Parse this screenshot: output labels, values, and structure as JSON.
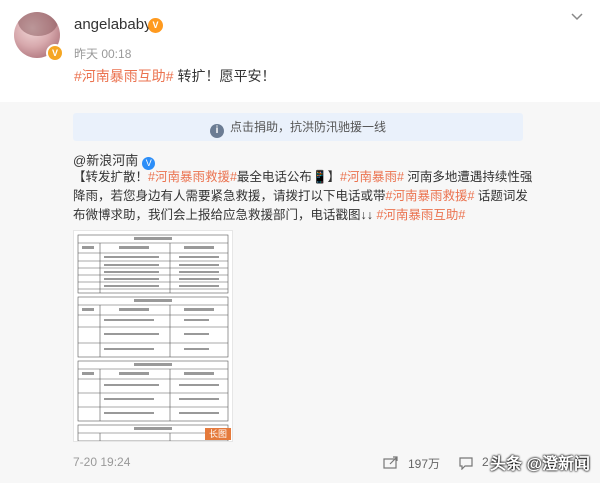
{
  "post": {
    "username": "angelababy",
    "vip_label": "V",
    "avatar_badge": "V",
    "time": "昨天 00:18",
    "topic": "#河南暴雨互助#",
    "text": " 转扩！愿平安！"
  },
  "repost": {
    "notice_icon": "i",
    "notice": "点击捐助，抗洪防汛驰援一线",
    "author": "@新浪河南",
    "verified": "V",
    "body_prefix": "【转发扩散！",
    "topic1": "#河南暴雨救援#",
    "body_mid1": "最全电话公布",
    "body_mid2": "】",
    "topic2": "#河南暴雨#",
    "body_mid3": " 河南多地遭遇持续性强降雨，若您身边有人需要紧急救援，请拨打以下电话或带",
    "topic3": "#河南暴雨救援#",
    "body_mid4": " 话题词发布微博求助，我们会上报给应急救援部门，电话戳图↓↓ ",
    "topic4": "#河南暴雨互助#",
    "image_tag": "长图"
  },
  "footer": {
    "time": "7-20 19:24",
    "share_count": "197万",
    "comment_count": "2"
  },
  "watermark": "头条 @澄新闻",
  "colors": {
    "topic": "#eb7350",
    "notice_bg": "#eaf1fb",
    "verified": "#2c8ef8"
  }
}
